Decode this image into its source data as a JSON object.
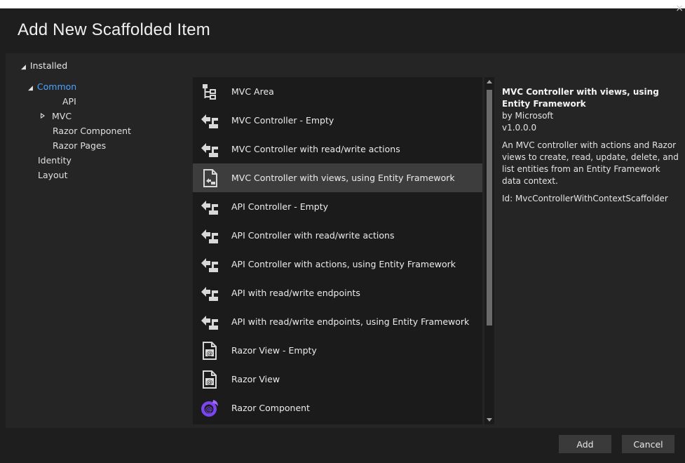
{
  "window": {
    "title": "Add New Scaffolded Item",
    "close_glyph": "×"
  },
  "tree": {
    "root": "Installed",
    "items": [
      {
        "label": "Common",
        "selected": true
      },
      {
        "label": "API"
      },
      {
        "label": "MVC"
      },
      {
        "label": "Razor Component"
      },
      {
        "label": "Razor Pages"
      },
      {
        "label": "Identity"
      },
      {
        "label": "Layout"
      }
    ]
  },
  "templates": [
    {
      "label": "MVC Area",
      "icon": "tree-structure-icon"
    },
    {
      "label": "MVC Controller - Empty",
      "icon": "controller-icon"
    },
    {
      "label": "MVC Controller with read/write actions",
      "icon": "controller-icon"
    },
    {
      "label": "MVC Controller with views, using Entity Framework",
      "icon": "document-controller-icon",
      "selected": true
    },
    {
      "label": "API Controller - Empty",
      "icon": "controller-icon"
    },
    {
      "label": "API Controller with read/write actions",
      "icon": "controller-icon"
    },
    {
      "label": "API Controller with actions, using Entity Framework",
      "icon": "controller-icon"
    },
    {
      "label": "API with read/write endpoints",
      "icon": "controller-icon"
    },
    {
      "label": "API with read/write endpoints, using Entity Framework",
      "icon": "controller-icon"
    },
    {
      "label": "Razor View - Empty",
      "icon": "razor-view-icon"
    },
    {
      "label": "Razor View",
      "icon": "razor-view-icon"
    },
    {
      "label": "Razor Component",
      "icon": "blazor-icon"
    }
  ],
  "details": {
    "title": "MVC Controller with views, using Entity Framework",
    "author": "by Microsoft",
    "version": "v1.0.0.0",
    "description": "An MVC controller with actions and Razor views to create, read, update, delete, and list entities from an Entity Framework data context.",
    "id": "Id: MvcControllerWithContextScaffolder"
  },
  "buttons": {
    "add": "Add",
    "cancel": "Cancel"
  },
  "colors": {
    "selection_text": "#4aa3ff",
    "selected_row": "#3d3d3d",
    "blazor": "#7b45ef"
  }
}
